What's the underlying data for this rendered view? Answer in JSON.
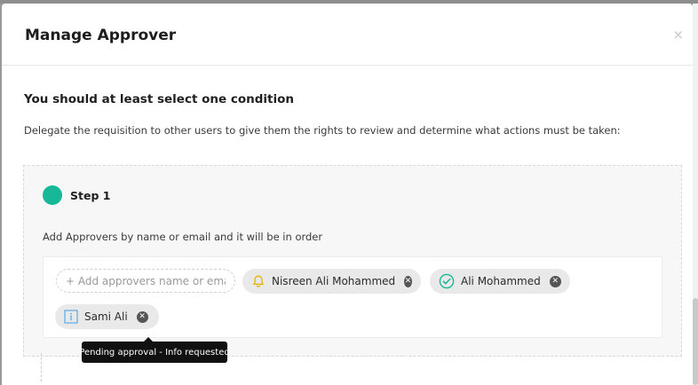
{
  "modal": {
    "title": "Manage Approver",
    "close_glyph": "×"
  },
  "content": {
    "heading": "You should at least select one condition",
    "description": "Delegate the requisition to other users to give them the rights to review and determine what actions must be taken:"
  },
  "step": {
    "label": "Step 1",
    "indicator_color": "#17b897",
    "hint": "Add Approvers by name or email and it will be in order",
    "add_input": {
      "placeholder": "+ Add approvers name or email",
      "value": ""
    },
    "approvers": [
      {
        "name": "Nisreen Ali Mohammed",
        "status_icon": "bell-icon",
        "status_color": "#e0b300"
      },
      {
        "name": "Ali Mohammed",
        "status_icon": "check-circle-icon",
        "status_color": "#17b897"
      },
      {
        "name": "Sami Ali",
        "status_icon": "info-icon",
        "status_color": "#5aa9e6"
      }
    ],
    "remove_glyph": "✕"
  },
  "tooltip": {
    "text": "Pending approval - Info requested"
  }
}
